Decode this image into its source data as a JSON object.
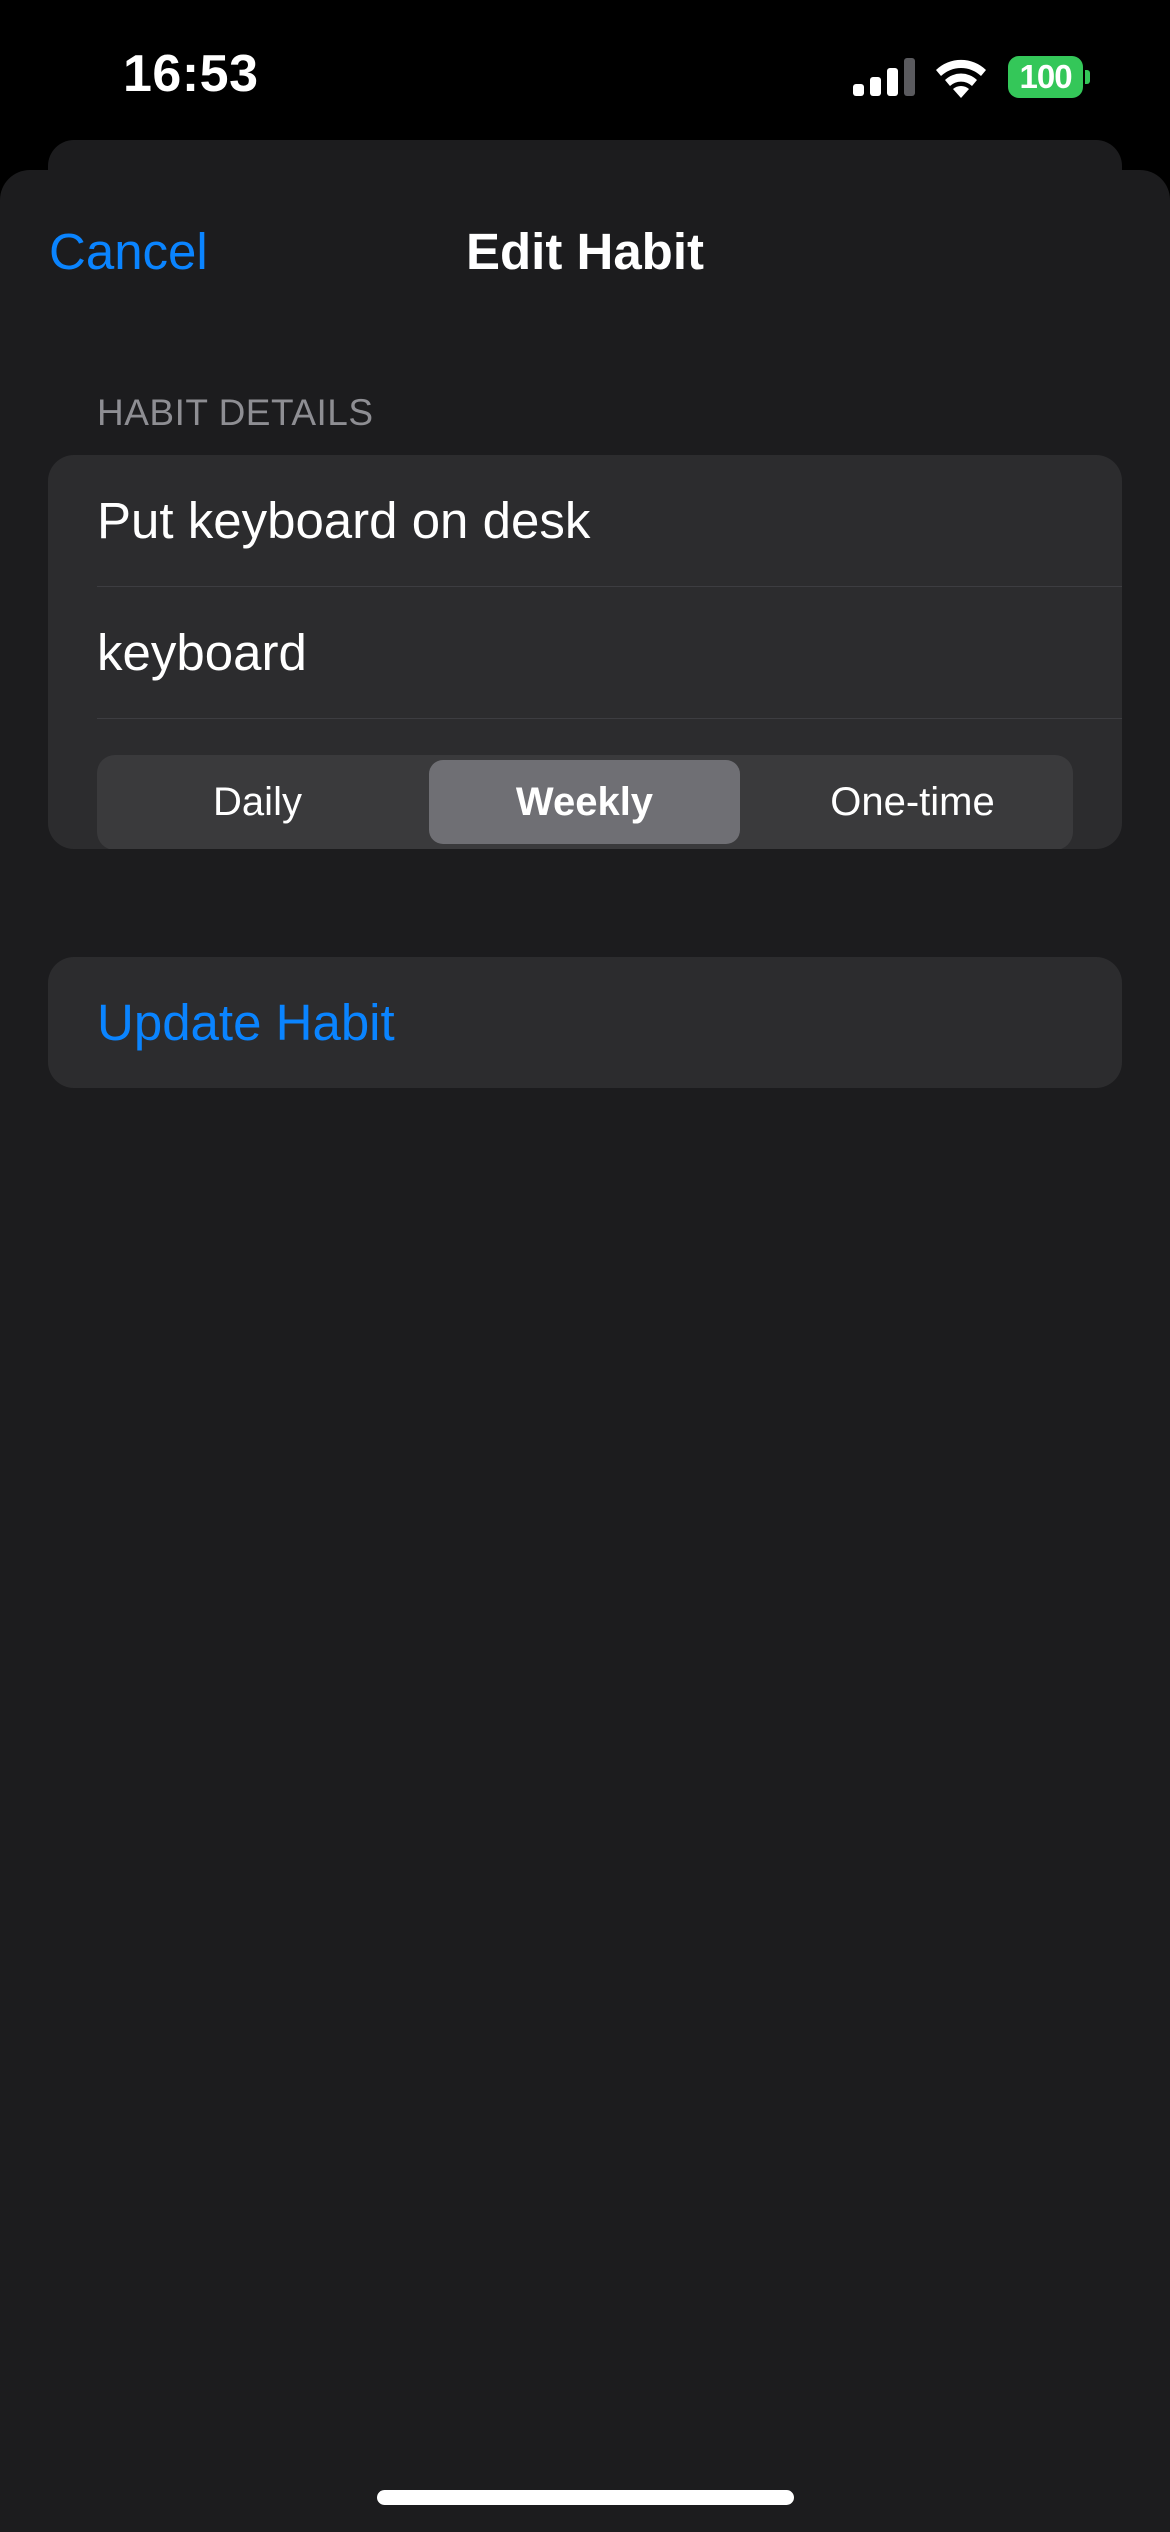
{
  "status_bar": {
    "time": "16:53",
    "battery_level": "100",
    "icons": [
      "signal-icon",
      "wifi-icon",
      "battery-icon"
    ],
    "battery_color": "#34c759"
  },
  "nav": {
    "cancel_label": "Cancel",
    "title": "Edit Habit"
  },
  "form": {
    "section_header": "HABIT DETAILS",
    "name_value": "Put keyboard on desk",
    "keyword_value": "keyboard",
    "frequency_options": [
      "Daily",
      "Weekly",
      "One-time"
    ],
    "frequency_selected": "Weekly",
    "update_label": "Update Habit"
  },
  "colors": {
    "accent": "#0a84ff",
    "background": "#1c1c1e",
    "grouped_cell": "#2c2c2e",
    "segment_selected": "#6f6f74"
  }
}
